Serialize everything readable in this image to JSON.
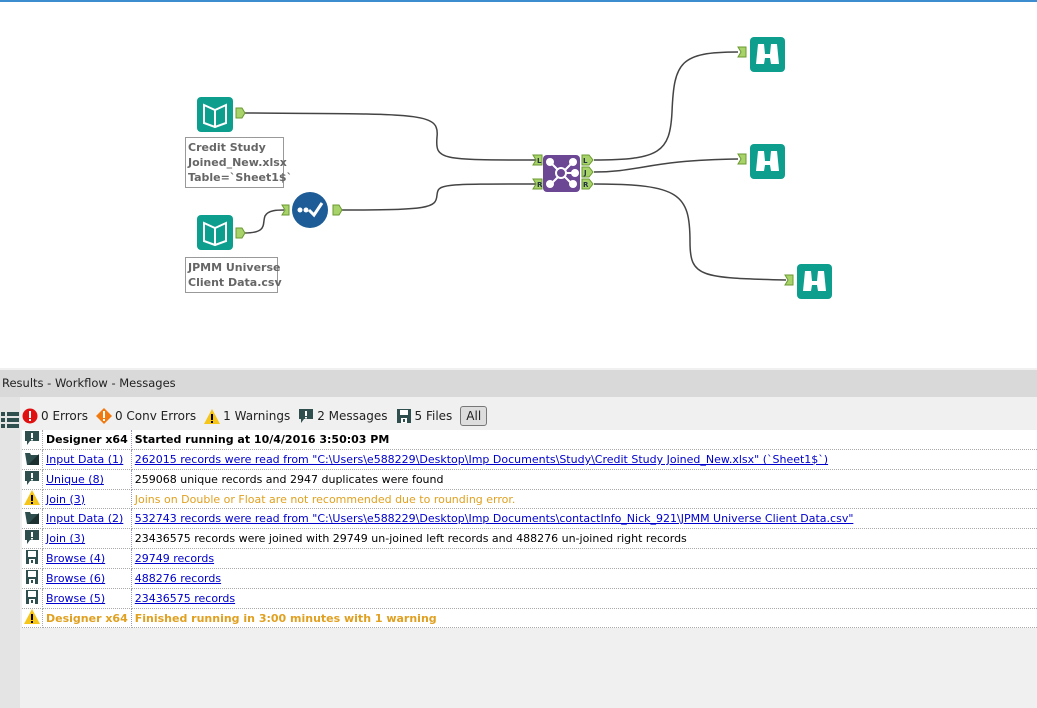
{
  "canvas": {
    "input1_label": "Credit Study\nJoined_New.xlsx\nTable=`Sheet1$`",
    "input2_label": "JPMM Universe\nClient Data.csv",
    "join_anchors": {
      "left": "L",
      "right": "R",
      "out_left": "L",
      "out_join": "J",
      "out_right": "R"
    }
  },
  "panel": {
    "title": "Results - Workflow - Messages"
  },
  "toolbar": {
    "errors": "0 Errors",
    "conv_errors": "0 Conv Errors",
    "warnings": "1 Warnings",
    "messages": "2 Messages",
    "files": "5 Files",
    "all": "All"
  },
  "messages": [
    {
      "icon": "message",
      "tool": "Designer x64",
      "text": "Started running  at 10/4/2016 3:50:03 PM",
      "style": "bold"
    },
    {
      "icon": "input",
      "tool": "Input Data (1)",
      "text": "262015 records were read from \"C:\\Users\\e588229\\Desktop\\Imp Documents\\Study\\Credit Study Joined_New.xlsx\" (`Sheet1$`)",
      "style": "link"
    },
    {
      "icon": "message",
      "tool": "Unique (8)",
      "text": "259068 unique records and 2947 duplicates were found",
      "style": "plain"
    },
    {
      "icon": "warning",
      "tool": "Join (3)",
      "text": "Joins on Double or Float are not recommended due to rounding error.",
      "style": "warn"
    },
    {
      "icon": "input",
      "tool": "Input Data (2)",
      "text": "532743 records were read from \"C:\\Users\\e588229\\Desktop\\Imp Documents\\contactInfo_Nick_921\\JPMM Universe Client Data.csv\"",
      "style": "link"
    },
    {
      "icon": "message",
      "tool": "Join (3)",
      "text": "23436575 records were joined with 29749 un-joined left records and 488276 un-joined right records",
      "style": "plain"
    },
    {
      "icon": "file",
      "tool": "Browse (4)",
      "text": "29749 records",
      "style": "link"
    },
    {
      "icon": "file",
      "tool": "Browse (6)",
      "text": "488276 records",
      "style": "link"
    },
    {
      "icon": "file",
      "tool": "Browse (5)",
      "text": "23436575 records",
      "style": "link"
    },
    {
      "icon": "warning",
      "tool": "Designer x64",
      "text": "Finished running  in 3:00 minutes with 1 warning",
      "style": "warnbold"
    }
  ],
  "colors": {
    "input": "#0e9e8e",
    "unique": "#1d5c96",
    "join": "#6b4794",
    "browse": "#0e9e8e",
    "anchor": "#a8d26a",
    "warning": "#e0a020",
    "link": "#0000cc"
  }
}
